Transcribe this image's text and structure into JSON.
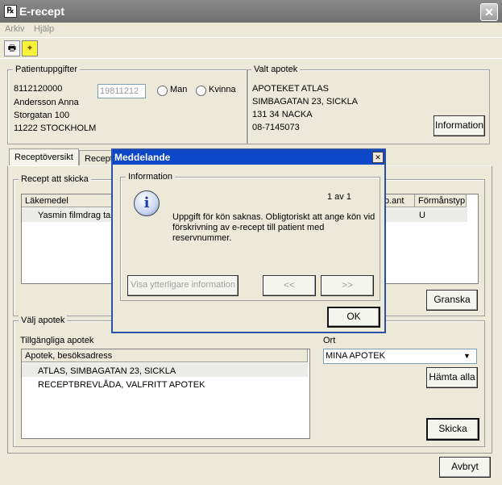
{
  "window": {
    "title": "E-recept"
  },
  "menu": [
    "Arkiv",
    "Hjälp"
  ],
  "toolbar": {
    "print_icon": "printer-icon",
    "new_icon": "new-document-icon"
  },
  "patient": {
    "group_title": "Patientuppgifter",
    "id": "8112120000",
    "reserve_number": "19811212",
    "name": "Andersson Anna",
    "street": "Storgatan 100",
    "city": "11222 STOCKHOLM",
    "gender_options": [
      "Man",
      "Kvinna"
    ]
  },
  "pharmacy": {
    "group_title": "Valt apotek",
    "name": "APOTEKET ATLAS",
    "street": "SIMBAGATAN 23, SICKLA",
    "city": "131 34 NACKA",
    "phone": "08-7145073",
    "info_button": "Information"
  },
  "tabs": [
    "Receptöversikt",
    "Recept"
  ],
  "recipes": {
    "group_title": "Recept att skicka",
    "columns": [
      "Läkemedel",
      "b.ant",
      "Förmånstyp"
    ],
    "rows": [
      {
        "drug": "Yasmin filmdrag tab",
        "benefit": "U"
      }
    ],
    "review_button": "Granska"
  },
  "choose_pharmacy": {
    "group_title": "Välj apotek",
    "available_label": "Tillgängliga apotek",
    "column": "Apotek, besöksadress",
    "items": [
      "ATLAS, SIMBAGATAN 23, SICKLA",
      "RECEPTBREVLÅDA, VALFRITT APOTEK"
    ],
    "place_label": "Ort",
    "place_value": "MINA APOTEK",
    "fetch_button": "Hämta alla",
    "send_button": "Skicka"
  },
  "cancel_button": "Avbryt",
  "dialog": {
    "title": "Meddelande",
    "group_title": "Information",
    "counter": "1 av 1",
    "message": "Uppgift för kön saknas. Obligtoriskt att ange kön vid förskrivning av e-recept till patient med reservnummer.",
    "more_info_button": "Visa ytterligare information",
    "prev_button": "<<",
    "next_button": ">>",
    "ok_button": "OK"
  }
}
